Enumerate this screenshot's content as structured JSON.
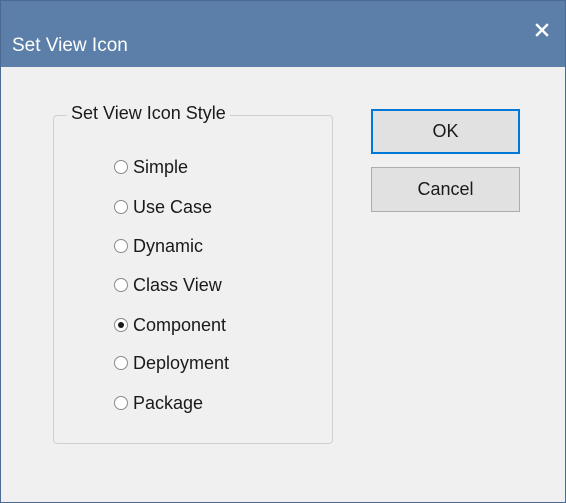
{
  "window": {
    "title": "Set View Icon",
    "close_icon": "close-icon"
  },
  "group": {
    "legend": "Set View Icon Style",
    "options": [
      {
        "label": "Simple",
        "selected": false
      },
      {
        "label": "Use Case",
        "selected": false
      },
      {
        "label": "Dynamic",
        "selected": false
      },
      {
        "label": "Class View",
        "selected": false
      },
      {
        "label": "Component",
        "selected": true
      },
      {
        "label": "Deployment",
        "selected": false
      },
      {
        "label": "Package",
        "selected": false
      }
    ]
  },
  "buttons": {
    "ok_label": "OK",
    "cancel_label": "Cancel"
  },
  "colors": {
    "titlebar": "#5b7fa9",
    "dialog_bg": "#f0f0f0",
    "default_button_border": "#0078d7"
  }
}
